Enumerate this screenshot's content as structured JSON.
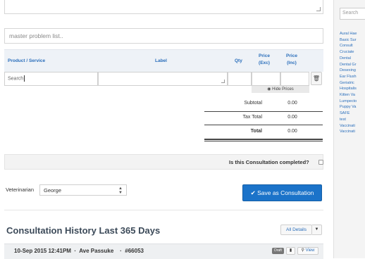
{
  "form": {
    "problem_placeholder": "master problem list.."
  },
  "table": {
    "headers": {
      "product": "Product / Service",
      "label": "Label",
      "qty": "Qty",
      "price_exc_1": "Price",
      "price_exc_2": "(Exc)",
      "price_inc_1": "Price",
      "price_inc_2": "(Inc)"
    },
    "search_value": "Search",
    "hide_prices": "Hide Prices"
  },
  "totals": {
    "subtotal_label": "Subtotal",
    "subtotal_value": "0.00",
    "tax_label": "Tax Total",
    "tax_value": "0.00",
    "total_label": "Total",
    "total_value": "0.00"
  },
  "completion": {
    "question": "Is this Consultation completed?"
  },
  "veterinarian": {
    "label": "Veterinarian",
    "selected": "George"
  },
  "actions": {
    "save_label": "Save as Consultation"
  },
  "history": {
    "title": "Consultation History Last 365 Days",
    "all_details": "All Details",
    "rows": [
      {
        "date": "10-Sep 2015 12:41PM",
        "name": "Ave Passuke",
        "number": "#66053",
        "badge": "Draft",
        "view_label": "View"
      }
    ]
  },
  "sidebar": {
    "search_placeholder": "Search",
    "items": [
      "Aural Hae",
      "Basic Sur",
      "Consult",
      "Cruciate",
      "Dental",
      "Dental Gr",
      "Desexing",
      "Ear Flush",
      "Geriatric",
      "Hospitalis",
      "Kitten Va",
      "Lumpecto",
      "Puppy Va",
      "SAFE",
      "test",
      "Vaccinati",
      "Vaccinati"
    ]
  },
  "colors": {
    "accent": "#1b73c9",
    "header_text": "#2a6ebb",
    "title": "#3c4a59"
  }
}
